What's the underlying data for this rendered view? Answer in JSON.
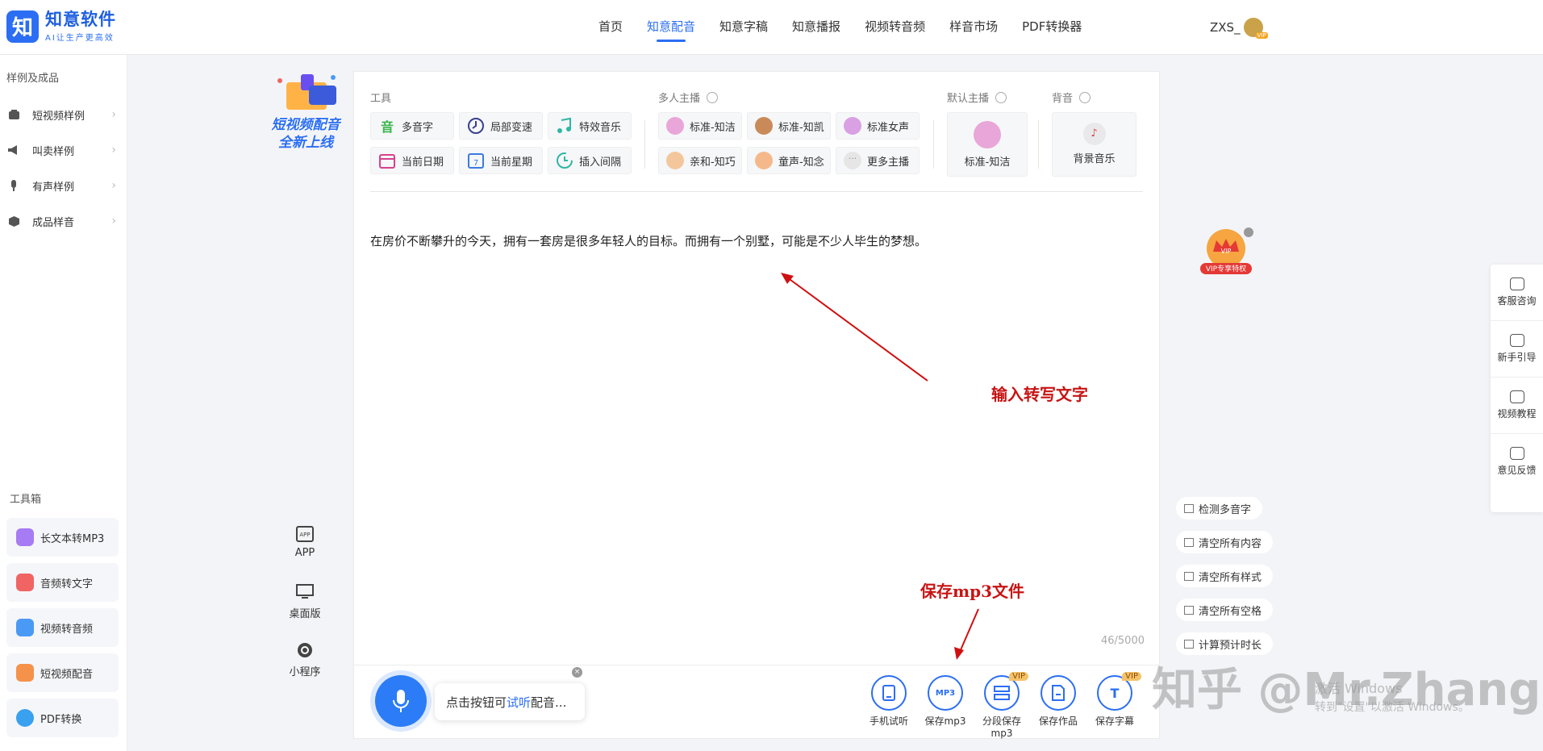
{
  "header": {
    "logo_mark": "知",
    "logo_name": "知意软件",
    "logo_slogan": "AI让生产更高效",
    "nav": [
      "首页",
      "知意配音",
      "知意字稿",
      "知意播报",
      "视频转音频",
      "样音市场",
      "PDF转换器"
    ],
    "active_nav": "知意配音",
    "user": "ZXS_",
    "user_vip": "VIP"
  },
  "sidebar": {
    "title": "样例及成品",
    "items": [
      "短视频样例",
      "叫卖样例",
      "有声样例",
      "成品样音"
    ],
    "toolbox_title": "工具箱",
    "tools": [
      "长文本转MP3",
      "音频转文字",
      "视频转音频",
      "短视频配音",
      "PDF转换"
    ]
  },
  "promo": {
    "line1": "短视频配音",
    "line2": "全新上线"
  },
  "apps": [
    "APP",
    "桌面版",
    "小程序"
  ],
  "app_icon_text": "APP",
  "editor": {
    "tools_label": "工具",
    "tools": [
      "多音字",
      "局部变速",
      "特效音乐",
      "当前日期",
      "当前星期",
      "插入间隔"
    ],
    "polyphone_icon": "音",
    "weekday_icon": "7",
    "multi_label": "多人主播",
    "multi": [
      "标准-知洁",
      "标准-知凯",
      "标准女声",
      "亲和-知巧",
      "童声-知念",
      "更多主播"
    ],
    "default_label": "默认主播",
    "default_anchor": "标准-知洁",
    "bgm_label": "背音",
    "bgm": "背景音乐",
    "text": "在房价不断攀升的今天，拥有一套房是很多年轻人的目标。而拥有一个别墅，可能是不少人毕生的梦想。",
    "counter": "46/5000",
    "annotation_input": "输入转写文字",
    "annotation_save": "保存mp3文件"
  },
  "bottom": {
    "tip_prefix": "点击按钮可",
    "tip_highlight": "试听",
    "tip_suffix": "配音...",
    "actions": [
      "手机试听",
      "保存mp3",
      "分段保存mp3",
      "保存作品",
      "保存字幕"
    ],
    "mp3_icon": "MP3",
    "subtitle_icon": "T",
    "vip": "VIP"
  },
  "right": {
    "vip_badge": "VIP专享特权",
    "vip_badge_icon": "VIP",
    "buttons": [
      "检测多音字",
      "清空所有内容",
      "清空所有样式",
      "清空所有空格",
      "计算预计时长"
    ],
    "float": [
      "客服咨询",
      "新手引导",
      "视频教程",
      "意见反馈"
    ]
  },
  "watermark": "知乎 @Mr.Zhang",
  "activation": {
    "line1": "激活 Windows",
    "line2": "转到\"设置\"以激活 Windows。"
  },
  "colors": {
    "accent": "#2b6ef3",
    "annotation": "#c81414"
  }
}
